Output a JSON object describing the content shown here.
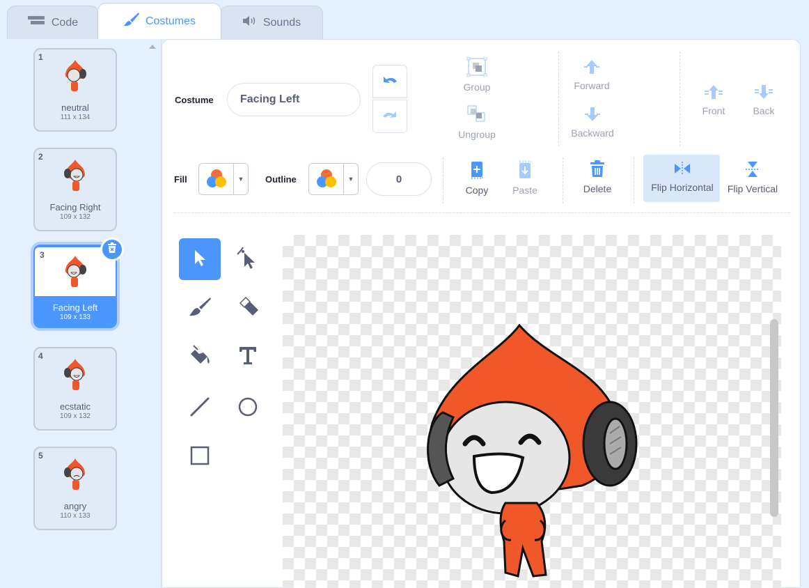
{
  "tabs": [
    {
      "label": "Code",
      "icon": "code-blocks-icon"
    },
    {
      "label": "Costumes",
      "icon": "paintbrush-icon"
    },
    {
      "label": "Sounds",
      "icon": "speaker-icon"
    }
  ],
  "costumes": [
    {
      "num": "1",
      "name": "neutral",
      "size": "111 x 134"
    },
    {
      "num": "2",
      "name": "Facing Right",
      "size": "109 x 132"
    },
    {
      "num": "3",
      "name": "Facing Left",
      "size": "109 x 133"
    },
    {
      "num": "4",
      "name": "ecstatic",
      "size": "109 x 132"
    },
    {
      "num": "5",
      "name": "angry",
      "size": "110 x 133"
    }
  ],
  "selected_costume": "3",
  "editor": {
    "costume_label": "Costume",
    "costume_name": "Facing Left",
    "group_label": "Group",
    "ungroup_label": "Ungroup",
    "forward_label": "Forward",
    "backward_label": "Backward",
    "front_label": "Front",
    "back_label": "Back",
    "fill_label": "Fill",
    "outline_label": "Outline",
    "outline_width": "0",
    "copy_label": "Copy",
    "paste_label": "Paste",
    "delete_label": "Delete",
    "flip_h_label": "Flip Horizontal",
    "flip_v_label": "Flip Vertical"
  },
  "tools": [
    "select-tool",
    "reshape-tool",
    "brush-tool",
    "eraser-tool",
    "fill-tool",
    "text-tool",
    "line-tool",
    "circle-tool",
    "rectangle-tool"
  ],
  "colors": {
    "accent": "#4c97ff",
    "character_orange": "#f0582a",
    "text": "#575e75"
  }
}
